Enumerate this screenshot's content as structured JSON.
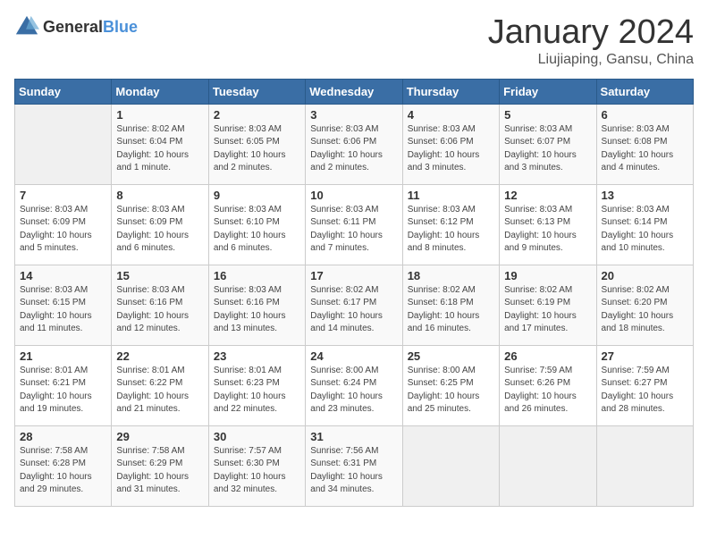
{
  "header": {
    "logo_general": "General",
    "logo_blue": "Blue",
    "month_year": "January 2024",
    "location": "Liujiaping, Gansu, China"
  },
  "days_of_week": [
    "Sunday",
    "Monday",
    "Tuesday",
    "Wednesday",
    "Thursday",
    "Friday",
    "Saturday"
  ],
  "weeks": [
    [
      {
        "day": "",
        "info": ""
      },
      {
        "day": "1",
        "info": "Sunrise: 8:02 AM\nSunset: 6:04 PM\nDaylight: 10 hours\nand 1 minute."
      },
      {
        "day": "2",
        "info": "Sunrise: 8:03 AM\nSunset: 6:05 PM\nDaylight: 10 hours\nand 2 minutes."
      },
      {
        "day": "3",
        "info": "Sunrise: 8:03 AM\nSunset: 6:06 PM\nDaylight: 10 hours\nand 2 minutes."
      },
      {
        "day": "4",
        "info": "Sunrise: 8:03 AM\nSunset: 6:06 PM\nDaylight: 10 hours\nand 3 minutes."
      },
      {
        "day": "5",
        "info": "Sunrise: 8:03 AM\nSunset: 6:07 PM\nDaylight: 10 hours\nand 3 minutes."
      },
      {
        "day": "6",
        "info": "Sunrise: 8:03 AM\nSunset: 6:08 PM\nDaylight: 10 hours\nand 4 minutes."
      }
    ],
    [
      {
        "day": "7",
        "info": "Sunrise: 8:03 AM\nSunset: 6:09 PM\nDaylight: 10 hours\nand 5 minutes."
      },
      {
        "day": "8",
        "info": "Sunrise: 8:03 AM\nSunset: 6:09 PM\nDaylight: 10 hours\nand 6 minutes."
      },
      {
        "day": "9",
        "info": "Sunrise: 8:03 AM\nSunset: 6:10 PM\nDaylight: 10 hours\nand 6 minutes."
      },
      {
        "day": "10",
        "info": "Sunrise: 8:03 AM\nSunset: 6:11 PM\nDaylight: 10 hours\nand 7 minutes."
      },
      {
        "day": "11",
        "info": "Sunrise: 8:03 AM\nSunset: 6:12 PM\nDaylight: 10 hours\nand 8 minutes."
      },
      {
        "day": "12",
        "info": "Sunrise: 8:03 AM\nSunset: 6:13 PM\nDaylight: 10 hours\nand 9 minutes."
      },
      {
        "day": "13",
        "info": "Sunrise: 8:03 AM\nSunset: 6:14 PM\nDaylight: 10 hours\nand 10 minutes."
      }
    ],
    [
      {
        "day": "14",
        "info": "Sunrise: 8:03 AM\nSunset: 6:15 PM\nDaylight: 10 hours\nand 11 minutes."
      },
      {
        "day": "15",
        "info": "Sunrise: 8:03 AM\nSunset: 6:16 PM\nDaylight: 10 hours\nand 12 minutes."
      },
      {
        "day": "16",
        "info": "Sunrise: 8:03 AM\nSunset: 6:16 PM\nDaylight: 10 hours\nand 13 minutes."
      },
      {
        "day": "17",
        "info": "Sunrise: 8:02 AM\nSunset: 6:17 PM\nDaylight: 10 hours\nand 14 minutes."
      },
      {
        "day": "18",
        "info": "Sunrise: 8:02 AM\nSunset: 6:18 PM\nDaylight: 10 hours\nand 16 minutes."
      },
      {
        "day": "19",
        "info": "Sunrise: 8:02 AM\nSunset: 6:19 PM\nDaylight: 10 hours\nand 17 minutes."
      },
      {
        "day": "20",
        "info": "Sunrise: 8:02 AM\nSunset: 6:20 PM\nDaylight: 10 hours\nand 18 minutes."
      }
    ],
    [
      {
        "day": "21",
        "info": "Sunrise: 8:01 AM\nSunset: 6:21 PM\nDaylight: 10 hours\nand 19 minutes."
      },
      {
        "day": "22",
        "info": "Sunrise: 8:01 AM\nSunset: 6:22 PM\nDaylight: 10 hours\nand 21 minutes."
      },
      {
        "day": "23",
        "info": "Sunrise: 8:01 AM\nSunset: 6:23 PM\nDaylight: 10 hours\nand 22 minutes."
      },
      {
        "day": "24",
        "info": "Sunrise: 8:00 AM\nSunset: 6:24 PM\nDaylight: 10 hours\nand 23 minutes."
      },
      {
        "day": "25",
        "info": "Sunrise: 8:00 AM\nSunset: 6:25 PM\nDaylight: 10 hours\nand 25 minutes."
      },
      {
        "day": "26",
        "info": "Sunrise: 7:59 AM\nSunset: 6:26 PM\nDaylight: 10 hours\nand 26 minutes."
      },
      {
        "day": "27",
        "info": "Sunrise: 7:59 AM\nSunset: 6:27 PM\nDaylight: 10 hours\nand 28 minutes."
      }
    ],
    [
      {
        "day": "28",
        "info": "Sunrise: 7:58 AM\nSunset: 6:28 PM\nDaylight: 10 hours\nand 29 minutes."
      },
      {
        "day": "29",
        "info": "Sunrise: 7:58 AM\nSunset: 6:29 PM\nDaylight: 10 hours\nand 31 minutes."
      },
      {
        "day": "30",
        "info": "Sunrise: 7:57 AM\nSunset: 6:30 PM\nDaylight: 10 hours\nand 32 minutes."
      },
      {
        "day": "31",
        "info": "Sunrise: 7:56 AM\nSunset: 6:31 PM\nDaylight: 10 hours\nand 34 minutes."
      },
      {
        "day": "",
        "info": ""
      },
      {
        "day": "",
        "info": ""
      },
      {
        "day": "",
        "info": ""
      }
    ]
  ]
}
